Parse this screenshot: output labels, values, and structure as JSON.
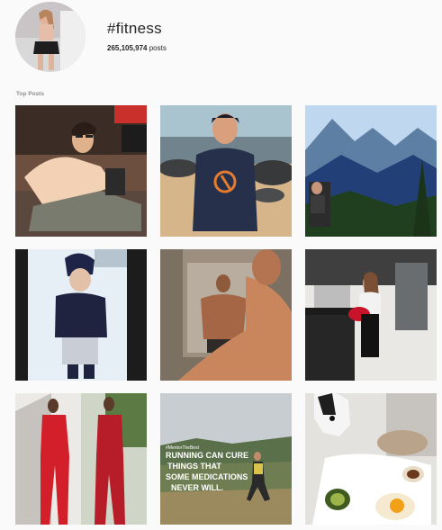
{
  "header": {
    "hashtag": "#fitness",
    "post_count": "265,105,974",
    "posts_label": "posts"
  },
  "sections": {
    "top_posts_label": "Top Posts"
  },
  "posts": [
    {
      "id": "p1",
      "desc": "man in sweater with glasses"
    },
    {
      "id": "p2",
      "desc": "man on rocky beach"
    },
    {
      "id": "p3",
      "desc": "mountain view"
    },
    {
      "id": "p4",
      "desc": "person in turban"
    },
    {
      "id": "p5",
      "desc": "mirror back selfie"
    },
    {
      "id": "p6",
      "desc": "woman in kitchen"
    },
    {
      "id": "p7",
      "desc": "women in red outfits"
    },
    {
      "id": "p8",
      "desc": "running poster"
    },
    {
      "id": "p9",
      "desc": "dog and breakfast"
    }
  ],
  "poster_text": {
    "tag": "#MentorTheBest",
    "line1": "RUNNING CAN CURE",
    "line2": "THINGS THAT",
    "line3": "SOME MEDICATIONS",
    "line4": "NEVER WILL."
  }
}
